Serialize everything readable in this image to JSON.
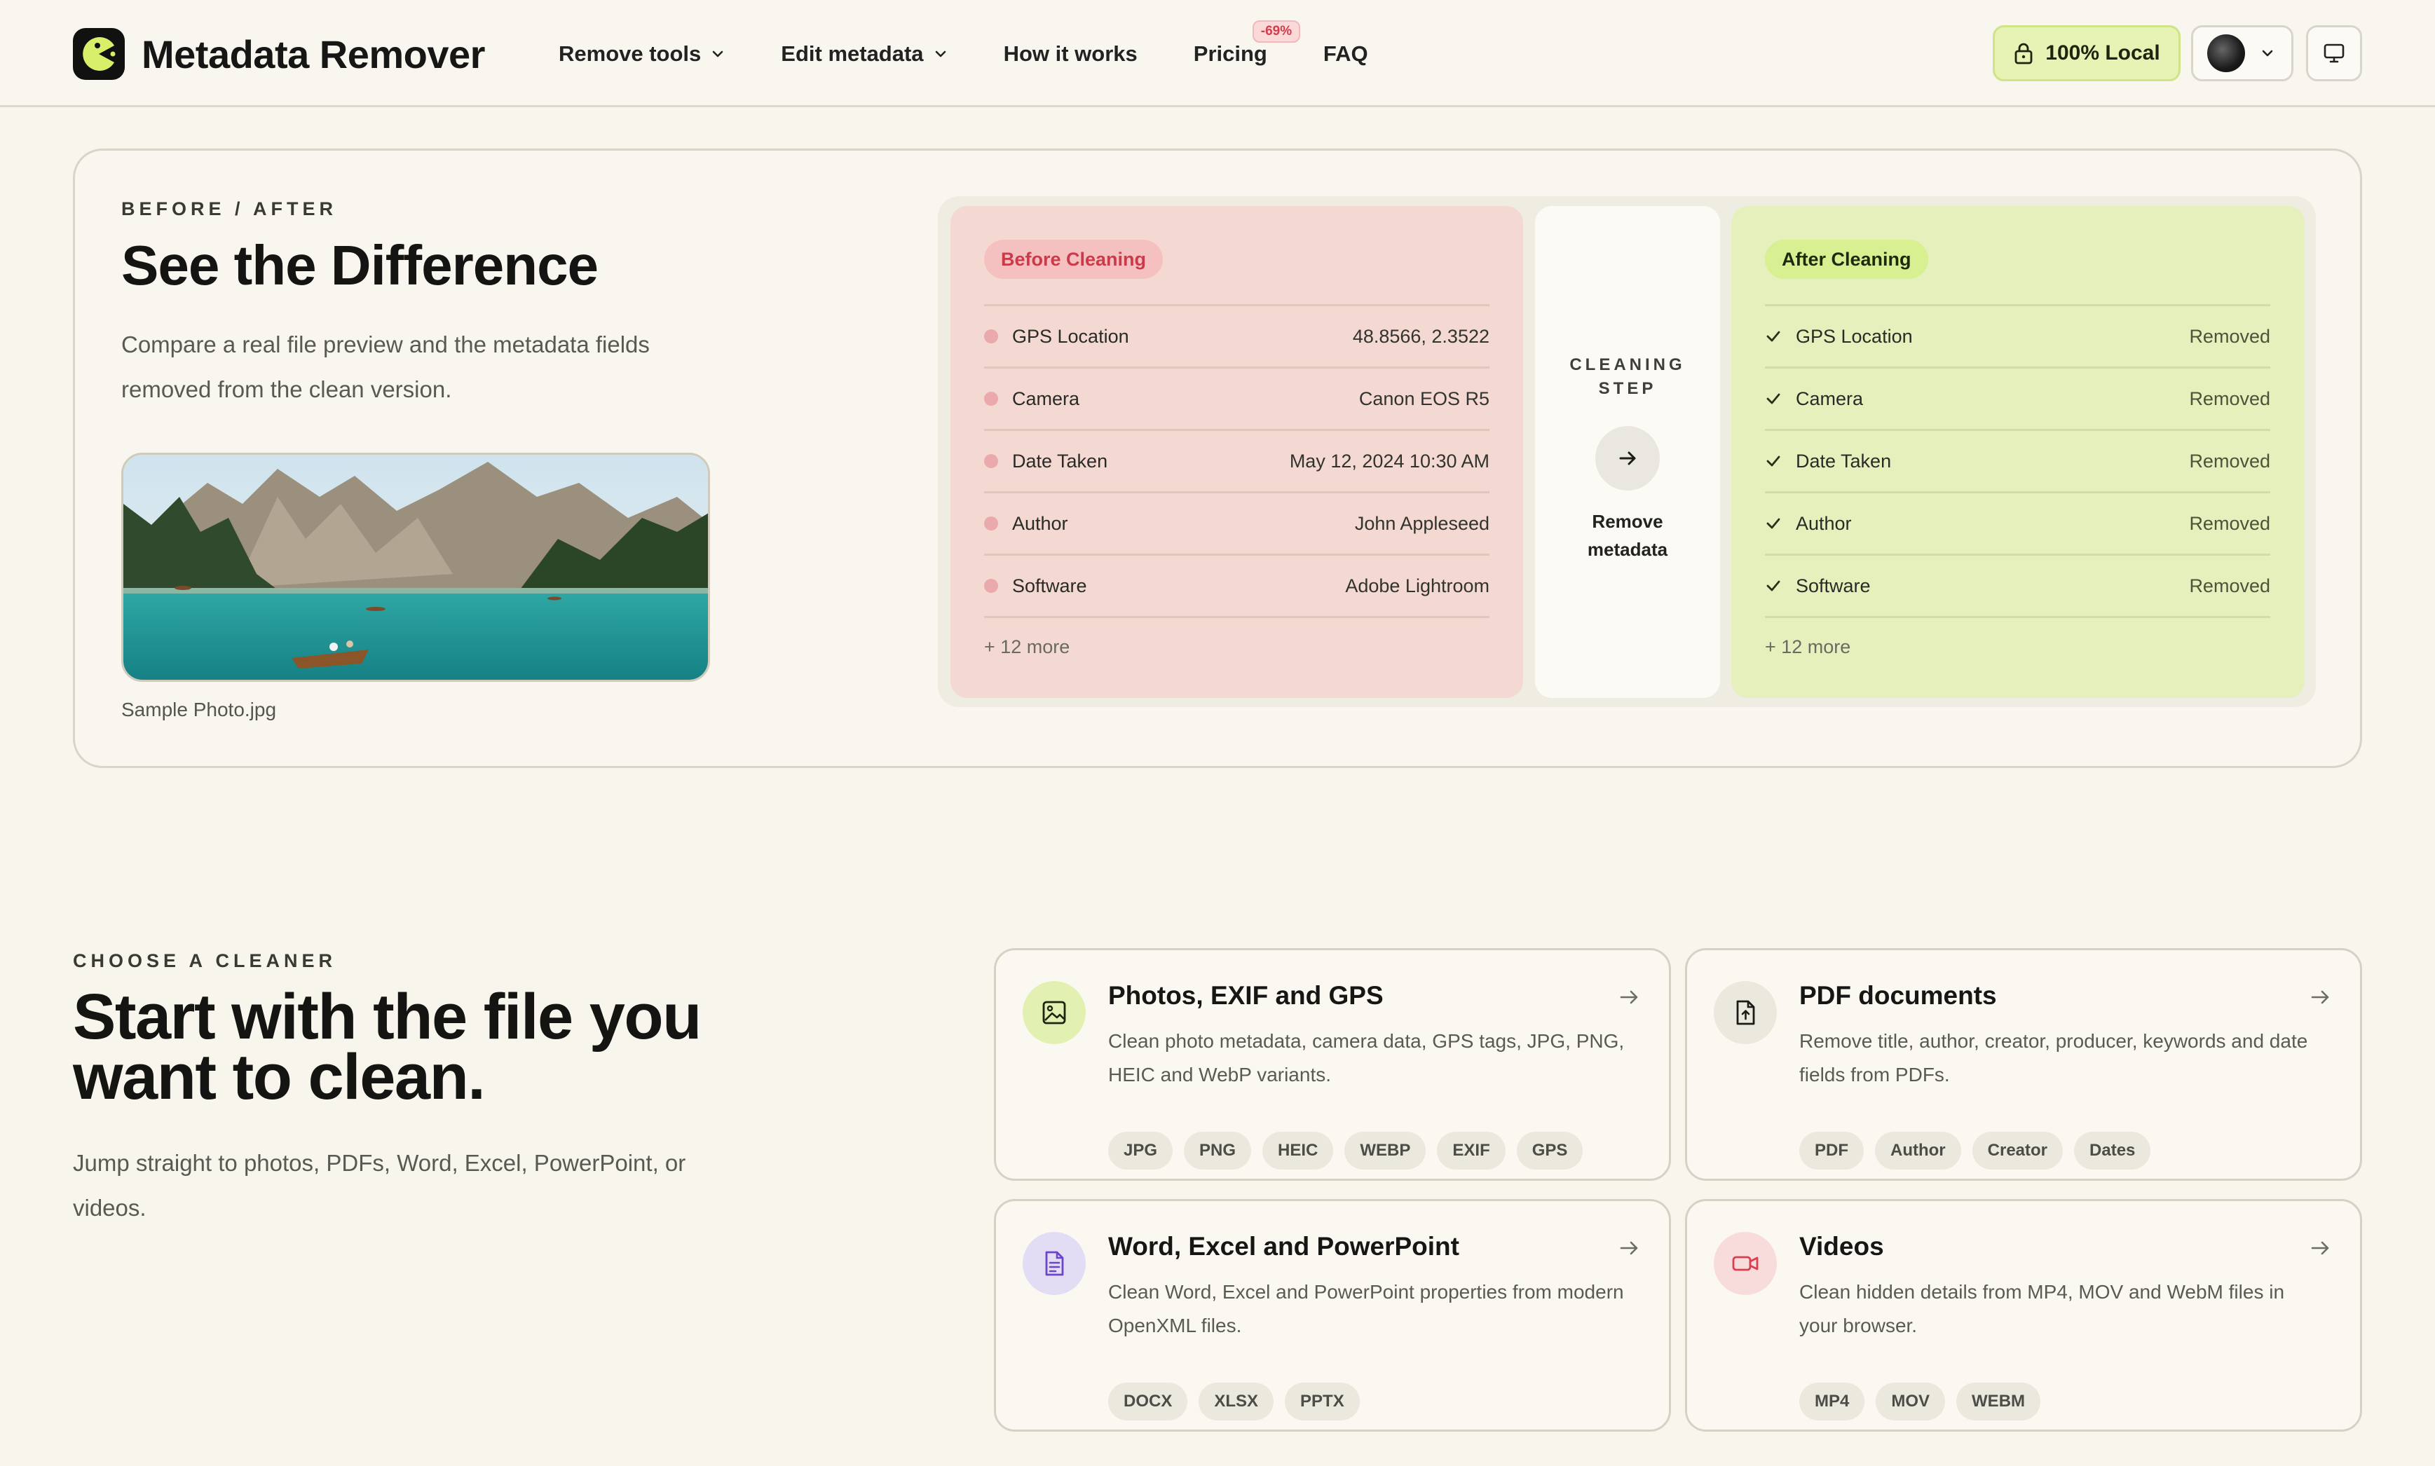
{
  "header": {
    "app_name": "Metadata Remover",
    "nav": [
      {
        "label": "Remove tools",
        "has_dropdown": true
      },
      {
        "label": "Edit metadata",
        "has_dropdown": true
      },
      {
        "label": "How it works",
        "has_dropdown": false
      },
      {
        "label": "Pricing",
        "badge": "-69%"
      },
      {
        "label": "FAQ",
        "has_dropdown": false
      }
    ],
    "local_button": "100% Local",
    "icons": {
      "lock": "lock-icon",
      "chevron": "chevron-down-icon",
      "display": "monitor-icon"
    }
  },
  "before_after": {
    "eyebrow": "BEFORE / AFTER",
    "title": "See the Difference",
    "description": "Compare a real file preview and the metadata fields removed from the clean version.",
    "photo_caption": "Sample Photo.jpg",
    "before": {
      "pill": "Before Cleaning",
      "rows": [
        {
          "label": "GPS Location",
          "value": "48.8566, 2.3522"
        },
        {
          "label": "Camera",
          "value": "Canon EOS R5"
        },
        {
          "label": "Date Taken",
          "value": "May 12, 2024 10:30 AM"
        },
        {
          "label": "Author",
          "value": "John Appleseed"
        },
        {
          "label": "Software",
          "value": "Adobe Lightroom"
        }
      ],
      "more": "+ 12 more"
    },
    "step": {
      "label_line1": "CLEANING",
      "label_line2": "STEP",
      "action_line1": "Remove",
      "action_line2": "metadata"
    },
    "after": {
      "pill": "After Cleaning",
      "rows": [
        {
          "label": "GPS Location",
          "value": "Removed"
        },
        {
          "label": "Camera",
          "value": "Removed"
        },
        {
          "label": "Date Taken",
          "value": "Removed"
        },
        {
          "label": "Author",
          "value": "Removed"
        },
        {
          "label": "Software",
          "value": "Removed"
        }
      ],
      "more": "+ 12 more"
    }
  },
  "cleaners": {
    "eyebrow": "CHOOSE A CLEANER",
    "title": "Start with the file you want to clean.",
    "description": "Jump straight to photos, PDFs, Word, Excel, PowerPoint, or videos.",
    "cards": [
      {
        "title": "Photos, EXIF and GPS",
        "description": "Clean photo metadata, camera data, GPS tags, JPG, PNG, HEIC and WebP variants.",
        "tags": [
          "JPG",
          "PNG",
          "HEIC",
          "WEBP",
          "EXIF",
          "GPS"
        ],
        "icon": "image-icon",
        "icon_color": "#e2f1b2"
      },
      {
        "title": "PDF documents",
        "description": "Remove title, author, creator, producer, keywords and date fields from PDFs.",
        "tags": [
          "PDF",
          "Author",
          "Creator",
          "Dates"
        ],
        "icon": "file-upload-icon",
        "icon_color": "#ebe8de"
      },
      {
        "title": "Word, Excel and PowerPoint",
        "description": "Clean Word, Excel and PowerPoint properties from modern OpenXML files.",
        "tags": [
          "DOCX",
          "XLSX",
          "PPTX"
        ],
        "icon": "document-icon",
        "icon_color": "#e3dcf5"
      },
      {
        "title": "Videos",
        "description": "Clean hidden details from MP4, MOV and WebM files in your browser.",
        "tags": [
          "MP4",
          "MOV",
          "WEBM"
        ],
        "icon": "video-camera-icon",
        "icon_color": "#f8dcdc"
      }
    ]
  },
  "colors": {
    "background": "#f7f5ec",
    "accent_lime": "#d8ef92",
    "before_panel": "#f3d9d2",
    "after_panel": "#e5f0bc",
    "badge_red": "#d43c4d"
  }
}
